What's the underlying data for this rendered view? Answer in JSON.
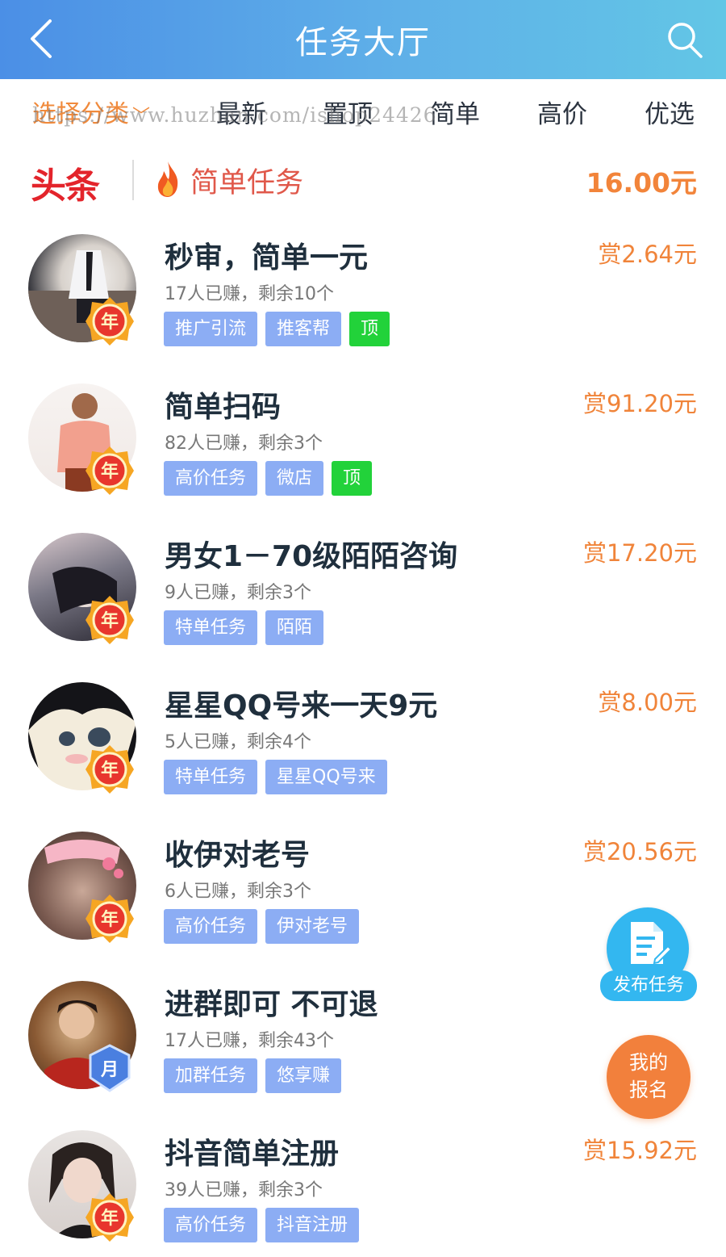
{
  "header": {
    "title": "任务大厅",
    "background_start": "#4b8fe6",
    "background_end": "#62c6e6"
  },
  "filter": {
    "select_label": "选择分类",
    "tabs": [
      "最新",
      "置顶",
      "简单",
      "高价",
      "优选"
    ],
    "accent": "#f08a3c"
  },
  "watermark": "https://www.huzhan.com/ishop24426",
  "headline": {
    "source": "头条",
    "text": "简单任务",
    "price": "16.00元"
  },
  "tasks": [
    {
      "title": "秒审，简单一元",
      "meta": "17人已赚，剩余10个",
      "tags": [
        "推广引流",
        "推客帮",
        "顶"
      ],
      "reward": "赏2.64元",
      "badge": "年"
    },
    {
      "title": "简单扫码",
      "meta": "82人已赚，剩余3个",
      "tags": [
        "高价任务",
        "微店",
        "顶"
      ],
      "reward": "赏91.20元",
      "badge": "年"
    },
    {
      "title": "男女1－70级陌陌咨询",
      "meta": "9人已赚，剩余3个",
      "tags": [
        "特单任务",
        "陌陌"
      ],
      "reward": "赏17.20元",
      "badge": "年"
    },
    {
      "title": "星星QQ号来一天9元",
      "meta": "5人已赚，剩余4个",
      "tags": [
        "特单任务",
        "星星QQ号来"
      ],
      "reward": "赏8.00元",
      "badge": "年"
    },
    {
      "title": "收伊对老号",
      "meta": "6人已赚，剩余3个",
      "tags": [
        "高价任务",
        "伊对老号"
      ],
      "reward": "赏20.56元",
      "badge": "年"
    },
    {
      "title": "进群即可 不可退",
      "meta": "17人已赚，剩余43个",
      "tags": [
        "加群任务",
        "悠享赚"
      ],
      "reward": "",
      "badge": "月"
    },
    {
      "title": "抖音简单注册",
      "meta": "39人已赚，剩余3个",
      "tags": [
        "高价任务",
        "抖音注册"
      ],
      "reward": "赏15.92元",
      "badge": "年"
    }
  ],
  "float": {
    "publish_label": "发布任务",
    "my_reg_line1": "我的",
    "my_reg_line2": "报名"
  },
  "icons": {
    "back": "back-arrow-icon",
    "search": "search-icon",
    "fire": "fire-icon",
    "publish": "document-edit-icon"
  }
}
